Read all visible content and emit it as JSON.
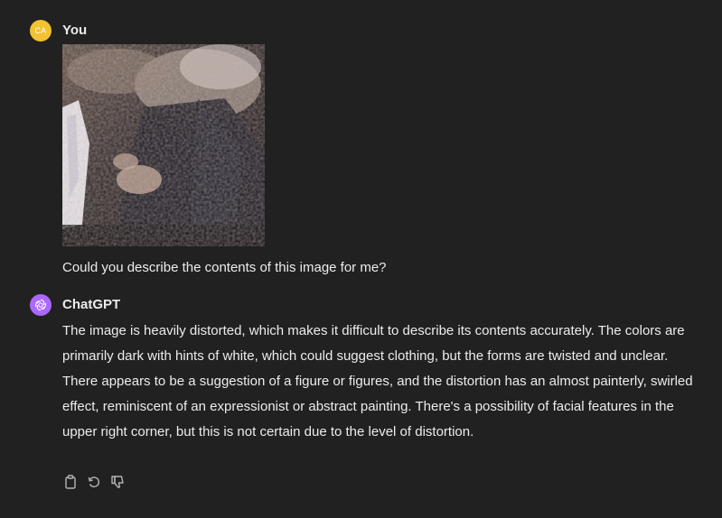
{
  "user_message": {
    "author": "You",
    "avatar_initials": "CA",
    "avatar_color": "#f1c232",
    "text": "Could you describe the contents of this image for me?"
  },
  "assistant_message": {
    "author": "ChatGPT",
    "avatar_icon": "openai-logo-icon",
    "avatar_color": "#ab68ff",
    "text": "The image is heavily distorted, which makes it difficult to describe its contents accurately. The colors are primarily dark with hints of white, which could suggest clothing, but the forms are twisted and unclear. There appears to be a suggestion of a figure or figures, and the distortion has an almost painterly, swirled effect, reminiscent of an expressionist or abstract painting. There's a possibility of facial features in the upper right corner, but this is not certain due to the level of distortion."
  },
  "actions": [
    {
      "icon": "copy-icon"
    },
    {
      "icon": "regenerate-icon"
    },
    {
      "icon": "thumbs-down-icon"
    }
  ],
  "colors": {
    "background": "#212121",
    "text": "#ececec",
    "icon": "#b4b4b4"
  }
}
